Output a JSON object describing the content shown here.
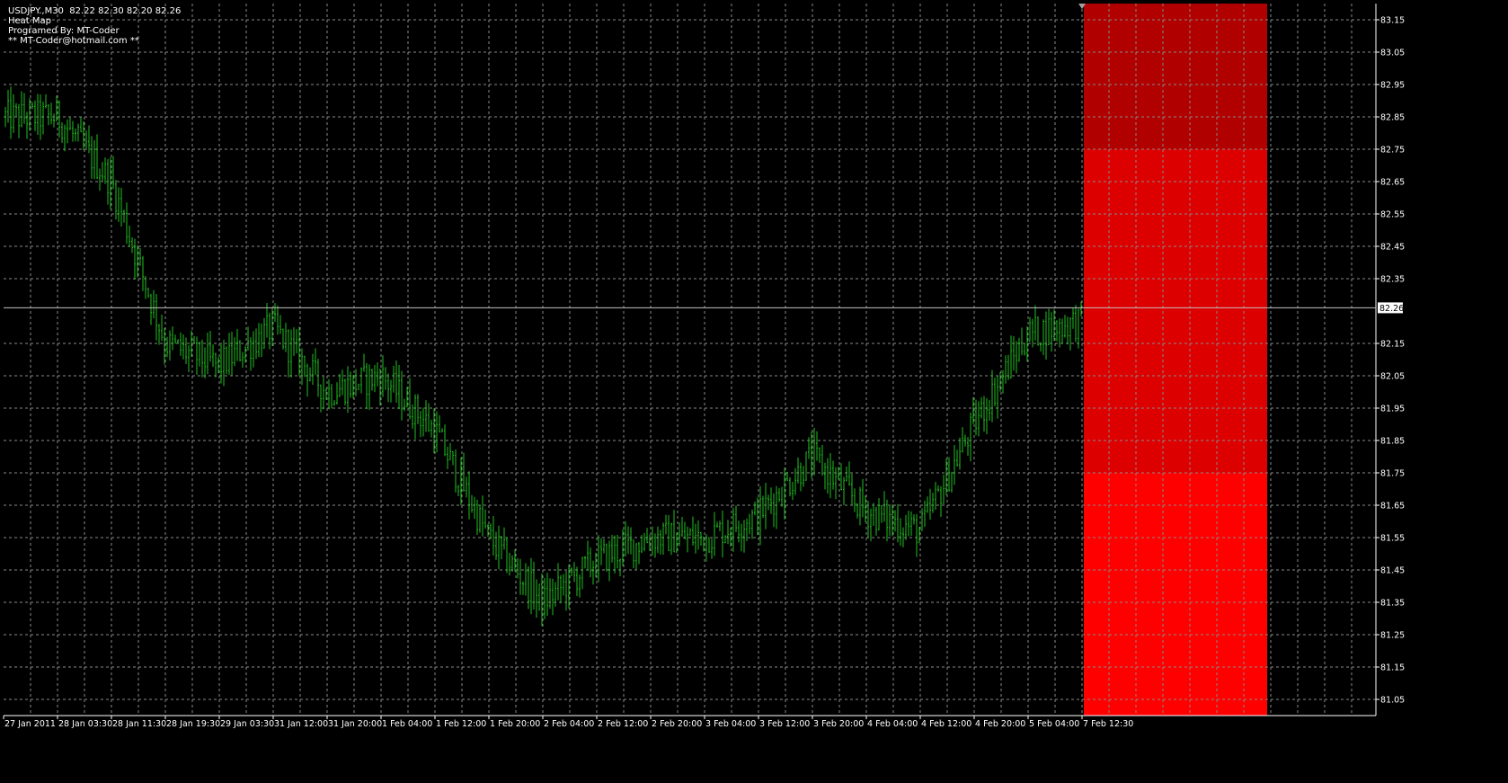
{
  "chart_info": {
    "symbol_line": "USDJPY.,M30  82.22 82.30 82.20 82.26",
    "indicator_name": "Heat Map",
    "author": "Programed By: MT-Coder",
    "email": "** MT-Coder@hotmail.com **"
  },
  "colors": {
    "background": "#000000",
    "grid": "#8a8a8a",
    "bars": "#22c022",
    "axis_text": "#ffffff",
    "current_price_line": "#c0c0c0",
    "heat_dark": "#b00000",
    "heat_mid": "#dd0000",
    "heat_bright": "#ff0000"
  },
  "chart_data": {
    "type": "ohlc",
    "title": "",
    "symbol": "USDJPY.",
    "timeframe": "M30",
    "last_quote": {
      "open": 82.22,
      "high": 82.3,
      "low": 82.2,
      "close": 82.26
    },
    "current_price": 82.26,
    "current_price_label": "82.26",
    "ylim": [
      81.0,
      83.2
    ],
    "y_ticks": [
      "83.15",
      "83.05",
      "82.95",
      "82.85",
      "82.75",
      "82.65",
      "82.55",
      "82.45",
      "82.35",
      "82.26",
      "82.15",
      "82.05",
      "81.95",
      "81.85",
      "81.75",
      "81.65",
      "81.55",
      "81.45",
      "81.35",
      "81.25",
      "81.15",
      "81.05"
    ],
    "x_tick_labels": [
      "27 Jan 2011",
      "28 Jan 03:30",
      "28 Jan 11:30",
      "28 Jan 19:30",
      "29 Jan 03:30",
      "31 Jan 12:00",
      "31 Jan 20:00",
      "1 Feb 04:00",
      "1 Feb 12:00",
      "1 Feb 20:00",
      "2 Feb 04:00",
      "2 Feb 12:00",
      "2 Feb 20:00",
      "3 Feb 04:00",
      "3 Feb 12:00",
      "3 Feb 20:00",
      "4 Feb 04:00",
      "4 Feb 12:00",
      "4 Feb 20:00",
      "5 Feb 04:00",
      "7 Feb 12:30"
    ],
    "grid": true,
    "price_path": [
      {
        "t": "27 Jan 2011",
        "price": 82.85
      },
      {
        "t": "28 Jan 03:30",
        "price": 82.85
      },
      {
        "t": "28 Jan 11:30",
        "price": 82.65
      },
      {
        "t": "28 Jan 19:30",
        "price": 82.15
      },
      {
        "t": "29 Jan 03:30",
        "price": 82.08
      },
      {
        "t": "31 Jan 12:00",
        "price": 82.2
      },
      {
        "t": "31 Jan 20:00",
        "price": 82.0
      },
      {
        "t": "1 Feb 04:00",
        "price": 82.05
      },
      {
        "t": "1 Feb 12:00",
        "price": 81.88
      },
      {
        "t": "1 Feb 20:00",
        "price": 81.55
      },
      {
        "t": "2 Feb 04:00",
        "price": 81.35
      },
      {
        "t": "2 Feb 12:00",
        "price": 81.48
      },
      {
        "t": "2 Feb 20:00",
        "price": 81.55
      },
      {
        "t": "3 Feb 04:00",
        "price": 81.55
      },
      {
        "t": "3 Feb 12:00",
        "price": 81.62
      },
      {
        "t": "3 Feb 20:00",
        "price": 81.8
      },
      {
        "t": "4 Feb 04:00",
        "price": 81.63
      },
      {
        "t": "4 Feb 12:00",
        "price": 81.57
      },
      {
        "t": "4 Feb 20:00",
        "price": 81.9
      },
      {
        "t": "5 Feb 04:00",
        "price": 82.18
      },
      {
        "t": "7 Feb 12:30",
        "price": 82.22
      }
    ],
    "heat_map": [
      {
        "from": 82.75,
        "to": 83.2,
        "level": "dark"
      },
      {
        "from": 81.75,
        "to": 82.75,
        "level": "mid"
      },
      {
        "from": 81.0,
        "to": 81.75,
        "level": "bright"
      }
    ]
  }
}
